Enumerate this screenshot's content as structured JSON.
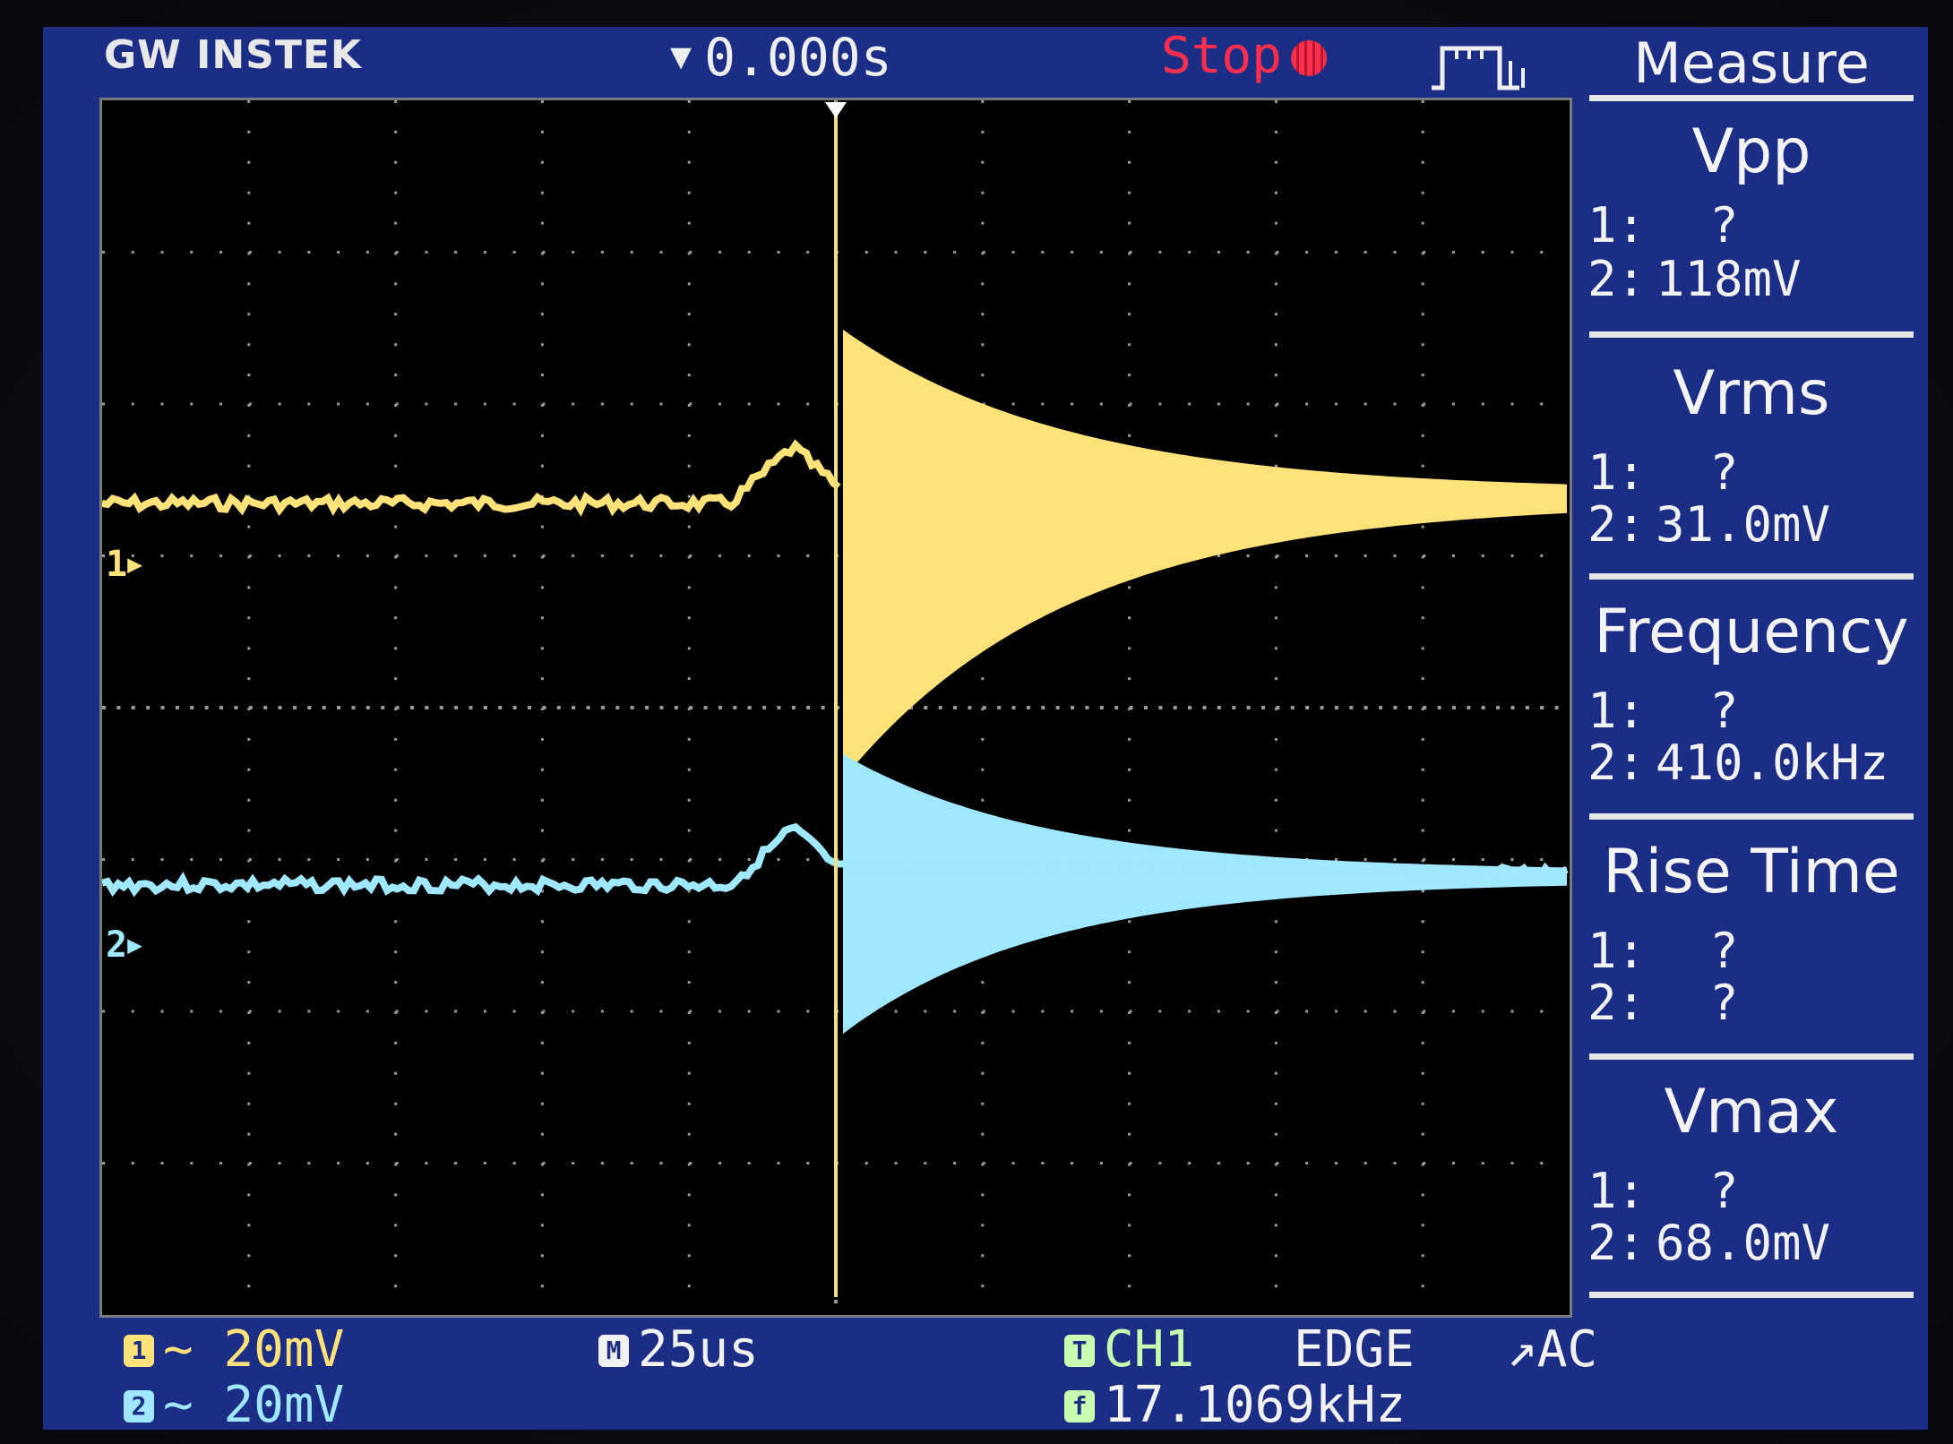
{
  "header": {
    "brand": "GW INSTEK",
    "time_position": "0.000s",
    "run_state": "Stop"
  },
  "colors": {
    "ch1": "#ffe27a",
    "ch2": "#9fe8ff",
    "trigger": "#c8ffb0",
    "screen_bg": "#1c2d86",
    "grid": "#9a9a9a",
    "stop": "#ff2e4c"
  },
  "icons": {
    "trigger_mode": "pulse-train-icon",
    "stop": "stop-dot-icon"
  },
  "channel_markers": {
    "ch1": "1",
    "ch2": "2"
  },
  "measure": {
    "title": "Measure",
    "items": [
      {
        "name": "Vpp",
        "ch1_label": "1:",
        "ch1": "?",
        "ch2_label": "2:",
        "ch2": "118mV"
      },
      {
        "name": "Vrms",
        "ch1_label": "1:",
        "ch1": "?",
        "ch2_label": "2:",
        "ch2": "31.0mV"
      },
      {
        "name": "Frequency",
        "ch1_label": "1:",
        "ch1": "?",
        "ch2_label": "2:",
        "ch2": "410.0kHz"
      },
      {
        "name": "Rise Time",
        "ch1_label": "1:",
        "ch1": "?",
        "ch2_label": "2:",
        "ch2": "?"
      },
      {
        "name": "Vmax",
        "ch1_label": "1:",
        "ch1": "?",
        "ch2_label": "2:",
        "ch2": "68.0mV"
      }
    ]
  },
  "status": {
    "ch1_badge": "1",
    "ch1_coupling": "~",
    "ch1_scale": "20mV",
    "ch2_badge": "2",
    "ch2_coupling": "~",
    "ch2_scale": "20mV",
    "time_badge": "M",
    "timebase": "25us",
    "trig_badge": "T",
    "trigger_source": "CH1",
    "trigger_type": "EDGE",
    "trigger_slope": "↗",
    "trigger_coupling": "AC",
    "freq_badge": "f",
    "trigger_frequency": "17.1069kHz"
  }
}
